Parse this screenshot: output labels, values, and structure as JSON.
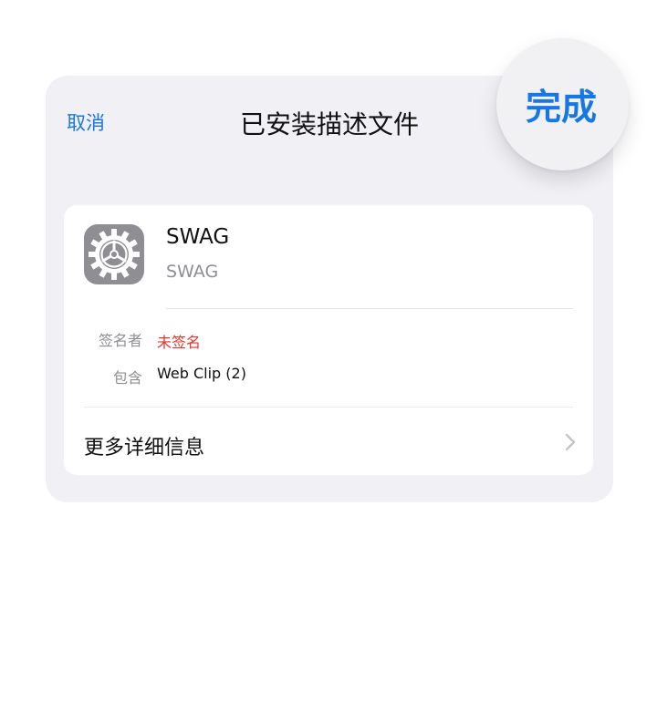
{
  "nav": {
    "cancel": "取消",
    "title": "已安装描述文件",
    "done": "完成"
  },
  "profile": {
    "name": "SWAG",
    "subtitle": "SWAG",
    "icon": "settings-gear-icon"
  },
  "details": [
    {
      "label": "签名者",
      "value": "未签名"
    },
    {
      "label": "包含",
      "value": "Web Clip (2)"
    }
  ],
  "more": {
    "label": "更多详细信息",
    "icon": "chevron-right-icon"
  },
  "colors": {
    "accent": "#1778e5",
    "unsigned": "#e8322c",
    "secondary_text": "#8e8e93",
    "sheet_bg": "#f0f0f5"
  }
}
